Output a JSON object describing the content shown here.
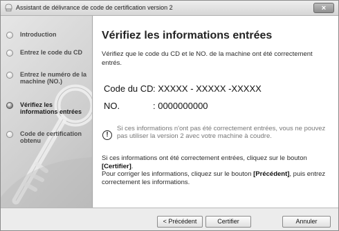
{
  "window": {
    "title": "Assistant de délivrance de code de certification version 2",
    "close_label": "×"
  },
  "sidebar": {
    "steps": [
      {
        "label": "Introduction",
        "active": false
      },
      {
        "label": "Entrez le code du CD",
        "active": false
      },
      {
        "label": "Entrez le numéro de la machine (NO.)",
        "active": false
      },
      {
        "label": "Vérifiez les informations entrées",
        "active": true
      },
      {
        "label": "Code de certification obtenu",
        "active": false
      }
    ]
  },
  "main": {
    "heading": "Vérifiez les informations entrées",
    "intro": "Vérifiez que le code du CD et le NO. de la machine ont été correctement entrés.",
    "cd_label": "Code du CD",
    "cd_value": ": XXXXX - XXXXX -XXXXX",
    "no_label": "NO.",
    "no_value": ": 0000000000",
    "warning_icon_glyph": "!",
    "warning": "Si ces informations n'ont pas été correctement entrées, vous ne pouvez pas utiliser la version 2 avec votre machine à coudre.",
    "line1": "Si ces informations ont été correctement entrées, cliquez sur le bouton",
    "line1_bold": "[Certifier]",
    "line1_end": ".",
    "line2": "Pour corriger les informations, cliquez sur le bouton",
    "line2_bold": "[Précédent]",
    "line2_end": ", puis entrez correctement les informations."
  },
  "buttons": {
    "prev": "< Précédent",
    "certify": "Certifier",
    "cancel": "Annuler"
  }
}
